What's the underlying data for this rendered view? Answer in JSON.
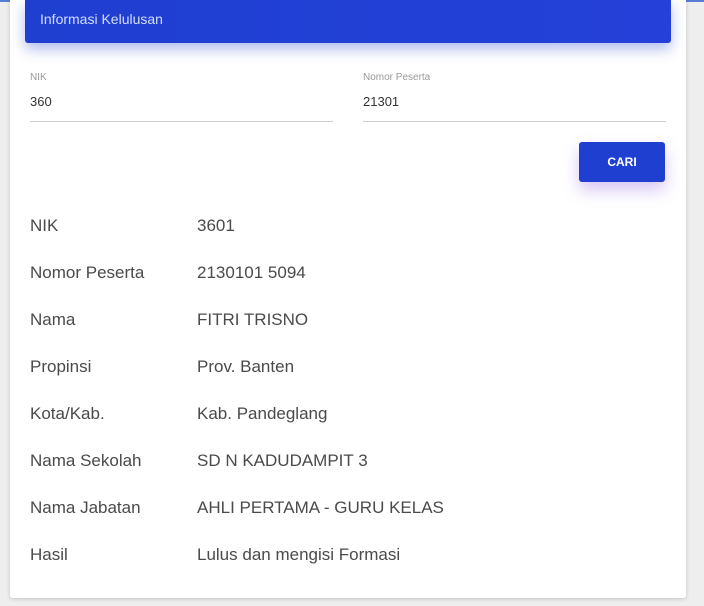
{
  "header": {
    "title": "Informasi Kelulusan"
  },
  "form": {
    "nik": {
      "label": "NIK",
      "value": "360"
    },
    "peserta": {
      "label": "Nomor Peserta",
      "value": "21301"
    },
    "search_button": "CARI"
  },
  "result": {
    "rows": [
      {
        "label": "NIK",
        "value": "3601"
      },
      {
        "label": "Nomor Peserta",
        "value": "2130101 5094"
      },
      {
        "label": "Nama",
        "value": "FITRI TRISNO"
      },
      {
        "label": "Propinsi",
        "value": "Prov. Banten"
      },
      {
        "label": "Kota/Kab.",
        "value": "Kab. Pandeglang"
      },
      {
        "label": "Nama Sekolah",
        "value": "SD N KADUDAMPIT 3"
      },
      {
        "label": "Nama Jabatan",
        "value": "AHLI PERTAMA - GURU KELAS"
      },
      {
        "label": "Hasil",
        "value": "Lulus dan mengisi Formasi"
      }
    ]
  },
  "colors": {
    "primary": "#1f3fd1",
    "text": "#4a4a4a",
    "label": "#9a9a9a"
  }
}
